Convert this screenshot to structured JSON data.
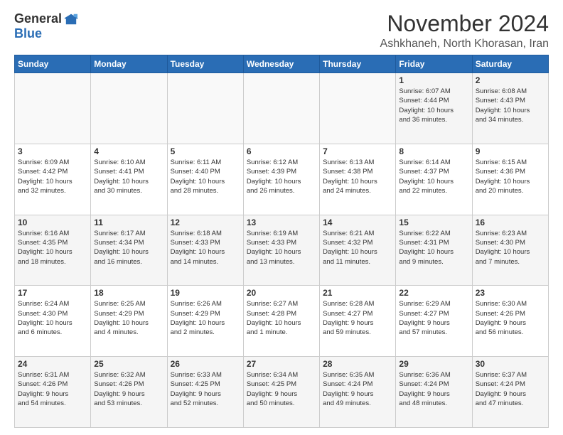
{
  "header": {
    "logo_general": "General",
    "logo_blue": "Blue",
    "month_title": "November 2024",
    "location": "Ashkhaneh, North Khorasan, Iran"
  },
  "weekdays": [
    "Sunday",
    "Monday",
    "Tuesday",
    "Wednesday",
    "Thursday",
    "Friday",
    "Saturday"
  ],
  "weeks": [
    [
      {
        "day": "",
        "info": ""
      },
      {
        "day": "",
        "info": ""
      },
      {
        "day": "",
        "info": ""
      },
      {
        "day": "",
        "info": ""
      },
      {
        "day": "",
        "info": ""
      },
      {
        "day": "1",
        "info": "Sunrise: 6:07 AM\nSunset: 4:44 PM\nDaylight: 10 hours\nand 36 minutes."
      },
      {
        "day": "2",
        "info": "Sunrise: 6:08 AM\nSunset: 4:43 PM\nDaylight: 10 hours\nand 34 minutes."
      }
    ],
    [
      {
        "day": "3",
        "info": "Sunrise: 6:09 AM\nSunset: 4:42 PM\nDaylight: 10 hours\nand 32 minutes."
      },
      {
        "day": "4",
        "info": "Sunrise: 6:10 AM\nSunset: 4:41 PM\nDaylight: 10 hours\nand 30 minutes."
      },
      {
        "day": "5",
        "info": "Sunrise: 6:11 AM\nSunset: 4:40 PM\nDaylight: 10 hours\nand 28 minutes."
      },
      {
        "day": "6",
        "info": "Sunrise: 6:12 AM\nSunset: 4:39 PM\nDaylight: 10 hours\nand 26 minutes."
      },
      {
        "day": "7",
        "info": "Sunrise: 6:13 AM\nSunset: 4:38 PM\nDaylight: 10 hours\nand 24 minutes."
      },
      {
        "day": "8",
        "info": "Sunrise: 6:14 AM\nSunset: 4:37 PM\nDaylight: 10 hours\nand 22 minutes."
      },
      {
        "day": "9",
        "info": "Sunrise: 6:15 AM\nSunset: 4:36 PM\nDaylight: 10 hours\nand 20 minutes."
      }
    ],
    [
      {
        "day": "10",
        "info": "Sunrise: 6:16 AM\nSunset: 4:35 PM\nDaylight: 10 hours\nand 18 minutes."
      },
      {
        "day": "11",
        "info": "Sunrise: 6:17 AM\nSunset: 4:34 PM\nDaylight: 10 hours\nand 16 minutes."
      },
      {
        "day": "12",
        "info": "Sunrise: 6:18 AM\nSunset: 4:33 PM\nDaylight: 10 hours\nand 14 minutes."
      },
      {
        "day": "13",
        "info": "Sunrise: 6:19 AM\nSunset: 4:33 PM\nDaylight: 10 hours\nand 13 minutes."
      },
      {
        "day": "14",
        "info": "Sunrise: 6:21 AM\nSunset: 4:32 PM\nDaylight: 10 hours\nand 11 minutes."
      },
      {
        "day": "15",
        "info": "Sunrise: 6:22 AM\nSunset: 4:31 PM\nDaylight: 10 hours\nand 9 minutes."
      },
      {
        "day": "16",
        "info": "Sunrise: 6:23 AM\nSunset: 4:30 PM\nDaylight: 10 hours\nand 7 minutes."
      }
    ],
    [
      {
        "day": "17",
        "info": "Sunrise: 6:24 AM\nSunset: 4:30 PM\nDaylight: 10 hours\nand 6 minutes."
      },
      {
        "day": "18",
        "info": "Sunrise: 6:25 AM\nSunset: 4:29 PM\nDaylight: 10 hours\nand 4 minutes."
      },
      {
        "day": "19",
        "info": "Sunrise: 6:26 AM\nSunset: 4:29 PM\nDaylight: 10 hours\nand 2 minutes."
      },
      {
        "day": "20",
        "info": "Sunrise: 6:27 AM\nSunset: 4:28 PM\nDaylight: 10 hours\nand 1 minute."
      },
      {
        "day": "21",
        "info": "Sunrise: 6:28 AM\nSunset: 4:27 PM\nDaylight: 9 hours\nand 59 minutes."
      },
      {
        "day": "22",
        "info": "Sunrise: 6:29 AM\nSunset: 4:27 PM\nDaylight: 9 hours\nand 57 minutes."
      },
      {
        "day": "23",
        "info": "Sunrise: 6:30 AM\nSunset: 4:26 PM\nDaylight: 9 hours\nand 56 minutes."
      }
    ],
    [
      {
        "day": "24",
        "info": "Sunrise: 6:31 AM\nSunset: 4:26 PM\nDaylight: 9 hours\nand 54 minutes."
      },
      {
        "day": "25",
        "info": "Sunrise: 6:32 AM\nSunset: 4:26 PM\nDaylight: 9 hours\nand 53 minutes."
      },
      {
        "day": "26",
        "info": "Sunrise: 6:33 AM\nSunset: 4:25 PM\nDaylight: 9 hours\nand 52 minutes."
      },
      {
        "day": "27",
        "info": "Sunrise: 6:34 AM\nSunset: 4:25 PM\nDaylight: 9 hours\nand 50 minutes."
      },
      {
        "day": "28",
        "info": "Sunrise: 6:35 AM\nSunset: 4:24 PM\nDaylight: 9 hours\nand 49 minutes."
      },
      {
        "day": "29",
        "info": "Sunrise: 6:36 AM\nSunset: 4:24 PM\nDaylight: 9 hours\nand 48 minutes."
      },
      {
        "day": "30",
        "info": "Sunrise: 6:37 AM\nSunset: 4:24 PM\nDaylight: 9 hours\nand 47 minutes."
      }
    ]
  ]
}
